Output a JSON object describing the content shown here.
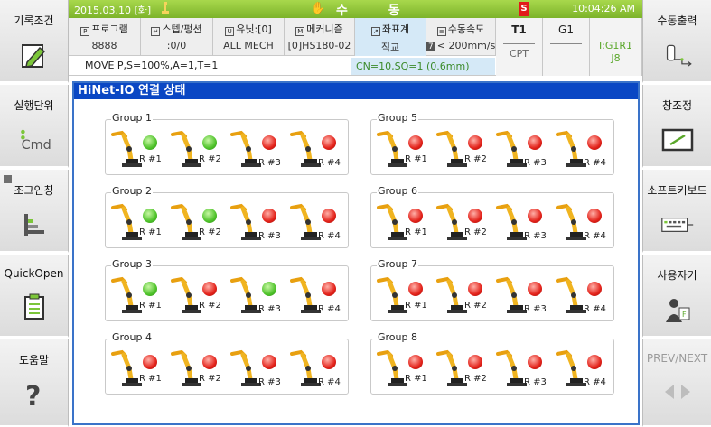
{
  "status_bar": {
    "datetime": "2015.03.10 [화]",
    "mode": "수 동",
    "badge": "S",
    "time": "10:04:26 AM"
  },
  "info": {
    "program_label": "프로그램",
    "program_value": "8888",
    "step_label": "스텝/펑션",
    "step_value": ":0/0",
    "unit_label": "유닛:[0]",
    "unit_value": "ALL MECH",
    "mechanism_label": "메커니즘",
    "mechanism_value": "[0]HS180-02",
    "coord_label": "좌표계",
    "coord_value": "직교",
    "speed_label": "수동속도",
    "speed_level": "7",
    "speed_value": "< 200mm/s",
    "tool1_top": "T1",
    "tool1_bottom": "CPT",
    "tool2_top": "G1",
    "tool2_bottom": "",
    "tool3_top": "I:G1R1",
    "tool3_bottom": "J8",
    "command": "MOVE P,S=100%,A=1,T=1",
    "cn_sq": "CN=10,SQ=1 (0.6mm)"
  },
  "left_menu": [
    {
      "label": "기록조건"
    },
    {
      "label": "실행단위"
    },
    {
      "label": "조그인칭"
    },
    {
      "label": "QuickOpen"
    },
    {
      "label": "도움말"
    }
  ],
  "right_menu": [
    {
      "label": "수동출력"
    },
    {
      "label": "창조정"
    },
    {
      "label": "소프트키보드"
    },
    {
      "label": "사용자키"
    },
    {
      "label": "PREV/NEXT"
    }
  ],
  "panel_title": "HiNet-IO 연결 상태",
  "colors": {
    "accent_green": "#7cb32a",
    "title_blue": "#0a47c4",
    "ok": "#4ec22a",
    "error": "#e3221a"
  },
  "groups": [
    {
      "name": "Group 1",
      "robots": [
        {
          "label": "R #1",
          "status": "green"
        },
        {
          "label": "R #2",
          "status": "green"
        },
        {
          "label": "R #3",
          "status": "red"
        },
        {
          "label": "R #4",
          "status": "red"
        }
      ]
    },
    {
      "name": "Group 2",
      "robots": [
        {
          "label": "R #1",
          "status": "green"
        },
        {
          "label": "R #2",
          "status": "green"
        },
        {
          "label": "R #3",
          "status": "red"
        },
        {
          "label": "R #4",
          "status": "red"
        }
      ]
    },
    {
      "name": "Group 3",
      "robots": [
        {
          "label": "R #1",
          "status": "green"
        },
        {
          "label": "R #2",
          "status": "red"
        },
        {
          "label": "R #3",
          "status": "green"
        },
        {
          "label": "R #4",
          "status": "red"
        }
      ]
    },
    {
      "name": "Group 4",
      "robots": [
        {
          "label": "R #1",
          "status": "red"
        },
        {
          "label": "R #2",
          "status": "red"
        },
        {
          "label": "R #3",
          "status": "red"
        },
        {
          "label": "R #4",
          "status": "red"
        }
      ]
    },
    {
      "name": "Group 5",
      "robots": [
        {
          "label": "R #1",
          "status": "red"
        },
        {
          "label": "R #2",
          "status": "red"
        },
        {
          "label": "R #3",
          "status": "red"
        },
        {
          "label": "R #4",
          "status": "red"
        }
      ]
    },
    {
      "name": "Group 6",
      "robots": [
        {
          "label": "R #1",
          "status": "red"
        },
        {
          "label": "R #2",
          "status": "red"
        },
        {
          "label": "R #3",
          "status": "red"
        },
        {
          "label": "R #4",
          "status": "red"
        }
      ]
    },
    {
      "name": "Group 7",
      "robots": [
        {
          "label": "R #1",
          "status": "red"
        },
        {
          "label": "R #2",
          "status": "red"
        },
        {
          "label": "R #3",
          "status": "red"
        },
        {
          "label": "R #4",
          "status": "red"
        }
      ]
    },
    {
      "name": "Group 8",
      "robots": [
        {
          "label": "R #1",
          "status": "red"
        },
        {
          "label": "R #2",
          "status": "red"
        },
        {
          "label": "R #3",
          "status": "red"
        },
        {
          "label": "R #4",
          "status": "red"
        }
      ]
    }
  ]
}
